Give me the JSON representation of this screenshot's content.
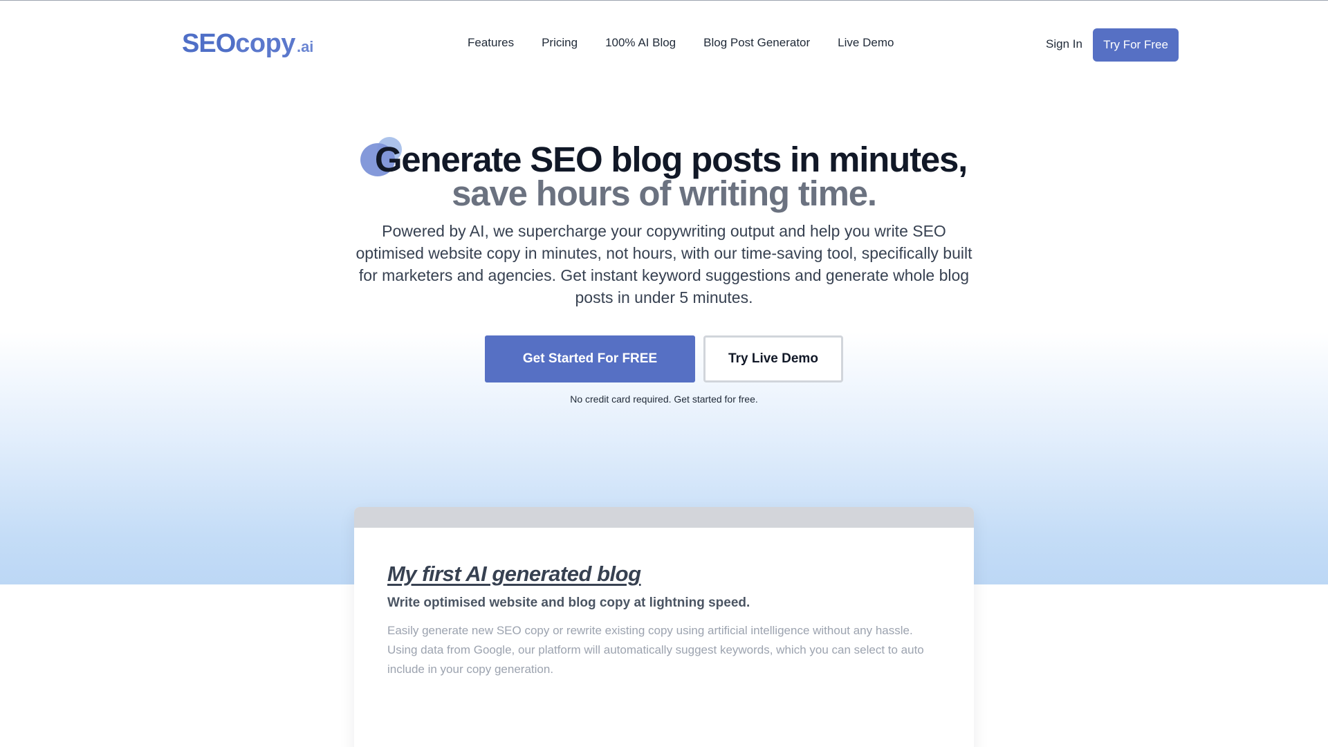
{
  "header": {
    "logo": {
      "main": "SEOcopy",
      "suffix": ".ai",
      "seo": "SEO",
      "copy": "copy"
    },
    "nav": [
      {
        "label": "Features"
      },
      {
        "label": "Pricing"
      },
      {
        "label": "100% AI Blog"
      },
      {
        "label": "Blog Post Generator"
      },
      {
        "label": "Live Demo"
      }
    ],
    "sign_in": "Sign In",
    "try_free": "Try For Free"
  },
  "hero": {
    "title_line1": "Generate SEO blog posts in minutes,",
    "title_line2": "save hours of writing time.",
    "description": "Powered by AI, we supercharge your copywriting output and help you write SEO optimised website copy in minutes, not hours, with our time-saving tool, specifically built for marketers and agencies. Get instant keyword suggestions and generate whole blog posts in under 5 minutes.",
    "cta_primary": "Get Started For FREE",
    "cta_secondary": "Try Live Demo",
    "note": "No credit card required. Get started for free."
  },
  "demo_card": {
    "title": "My first AI generated blog",
    "subtitle": "Write optimised website and blog copy at lightning speed.",
    "body": "Easily generate new SEO copy or rewrite existing copy using artificial intelligence without any hassle. Using data from Google, our platform will automatically suggest keywords, which you can select to auto include in your copy generation."
  },
  "colors": {
    "brand": "#5670c4",
    "hero_gradient_end": "#bcd7f5",
    "title_dark": "#111827",
    "title_muted": "#6b7280"
  }
}
